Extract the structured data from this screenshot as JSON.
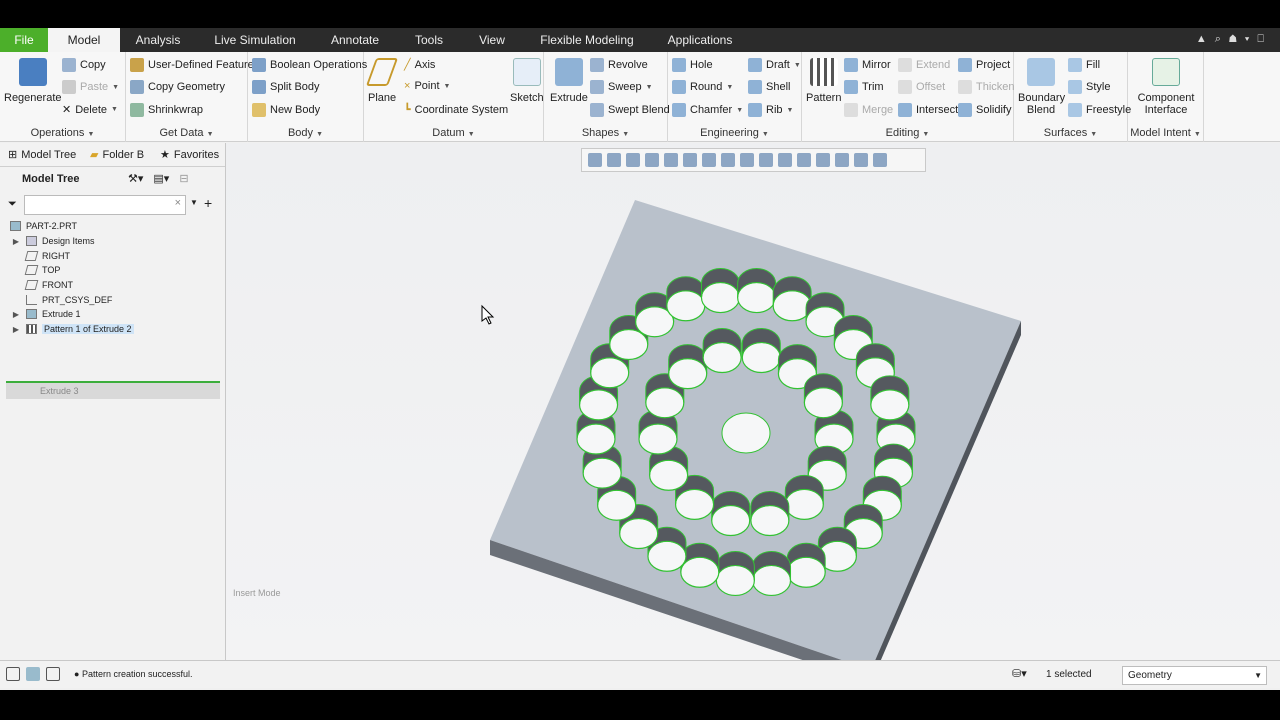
{
  "tabs": [
    "File",
    "Model",
    "Analysis",
    "Live Simulation",
    "Annotate",
    "Tools",
    "View",
    "Flexible Modeling",
    "Applications"
  ],
  "ribbon": {
    "operations": {
      "label": "Operations",
      "regenerate": "Regenerate",
      "copy": "Copy",
      "paste": "Paste",
      "delete": "Delete"
    },
    "get_data": {
      "label": "Get Data",
      "udf": "User-Defined Feature",
      "copy_geometry": "Copy Geometry",
      "shrinkwrap": "Shrinkwrap"
    },
    "body": {
      "label": "Body",
      "boolean": "Boolean Operations",
      "split": "Split Body",
      "new": "New Body"
    },
    "datum": {
      "label": "Datum",
      "plane": "Plane",
      "axis": "Axis",
      "point": "Point",
      "csys": "Coordinate System",
      "sketch": "Sketch"
    },
    "shapes": {
      "label": "Shapes",
      "extrude": "Extrude",
      "revolve": "Revolve",
      "sweep": "Sweep",
      "swept_blend": "Swept Blend"
    },
    "engineering": {
      "label": "Engineering",
      "hole": "Hole",
      "round": "Round",
      "chamfer": "Chamfer",
      "draft": "Draft",
      "shell": "Shell",
      "rib": "Rib"
    },
    "editing": {
      "label": "Editing",
      "pattern": "Pattern",
      "mirror": "Mirror",
      "trim": "Trim",
      "merge": "Merge",
      "extend": "Extend",
      "offset": "Offset",
      "intersect": "Intersect",
      "project": "Project",
      "thicken": "Thicken",
      "solidify": "Solidify"
    },
    "surfaces": {
      "label": "Surfaces",
      "boundary_blend": "Boundary Blend",
      "fill": "Fill",
      "style": "Style",
      "freestyle": "Freestyle"
    },
    "model_intent": {
      "label": "Model Intent",
      "component_interface": "Component Interface"
    }
  },
  "left_panel": {
    "tabs": [
      "Model Tree",
      "Folder B",
      "Favorites"
    ],
    "tree_title": "Model Tree",
    "items": [
      "PART-2.PRT",
      "Design Items",
      "RIGHT",
      "TOP",
      "FRONT",
      "PRT_CSYS_DEF",
      "Extrude 1",
      "Pattern 1 of Extrude 2"
    ],
    "insert_item": "Extrude 3"
  },
  "viewport": {
    "mode": "Insert Mode"
  },
  "status": {
    "message": "Pattern creation successful.",
    "selected": "1 selected",
    "filter": "Geometry"
  }
}
